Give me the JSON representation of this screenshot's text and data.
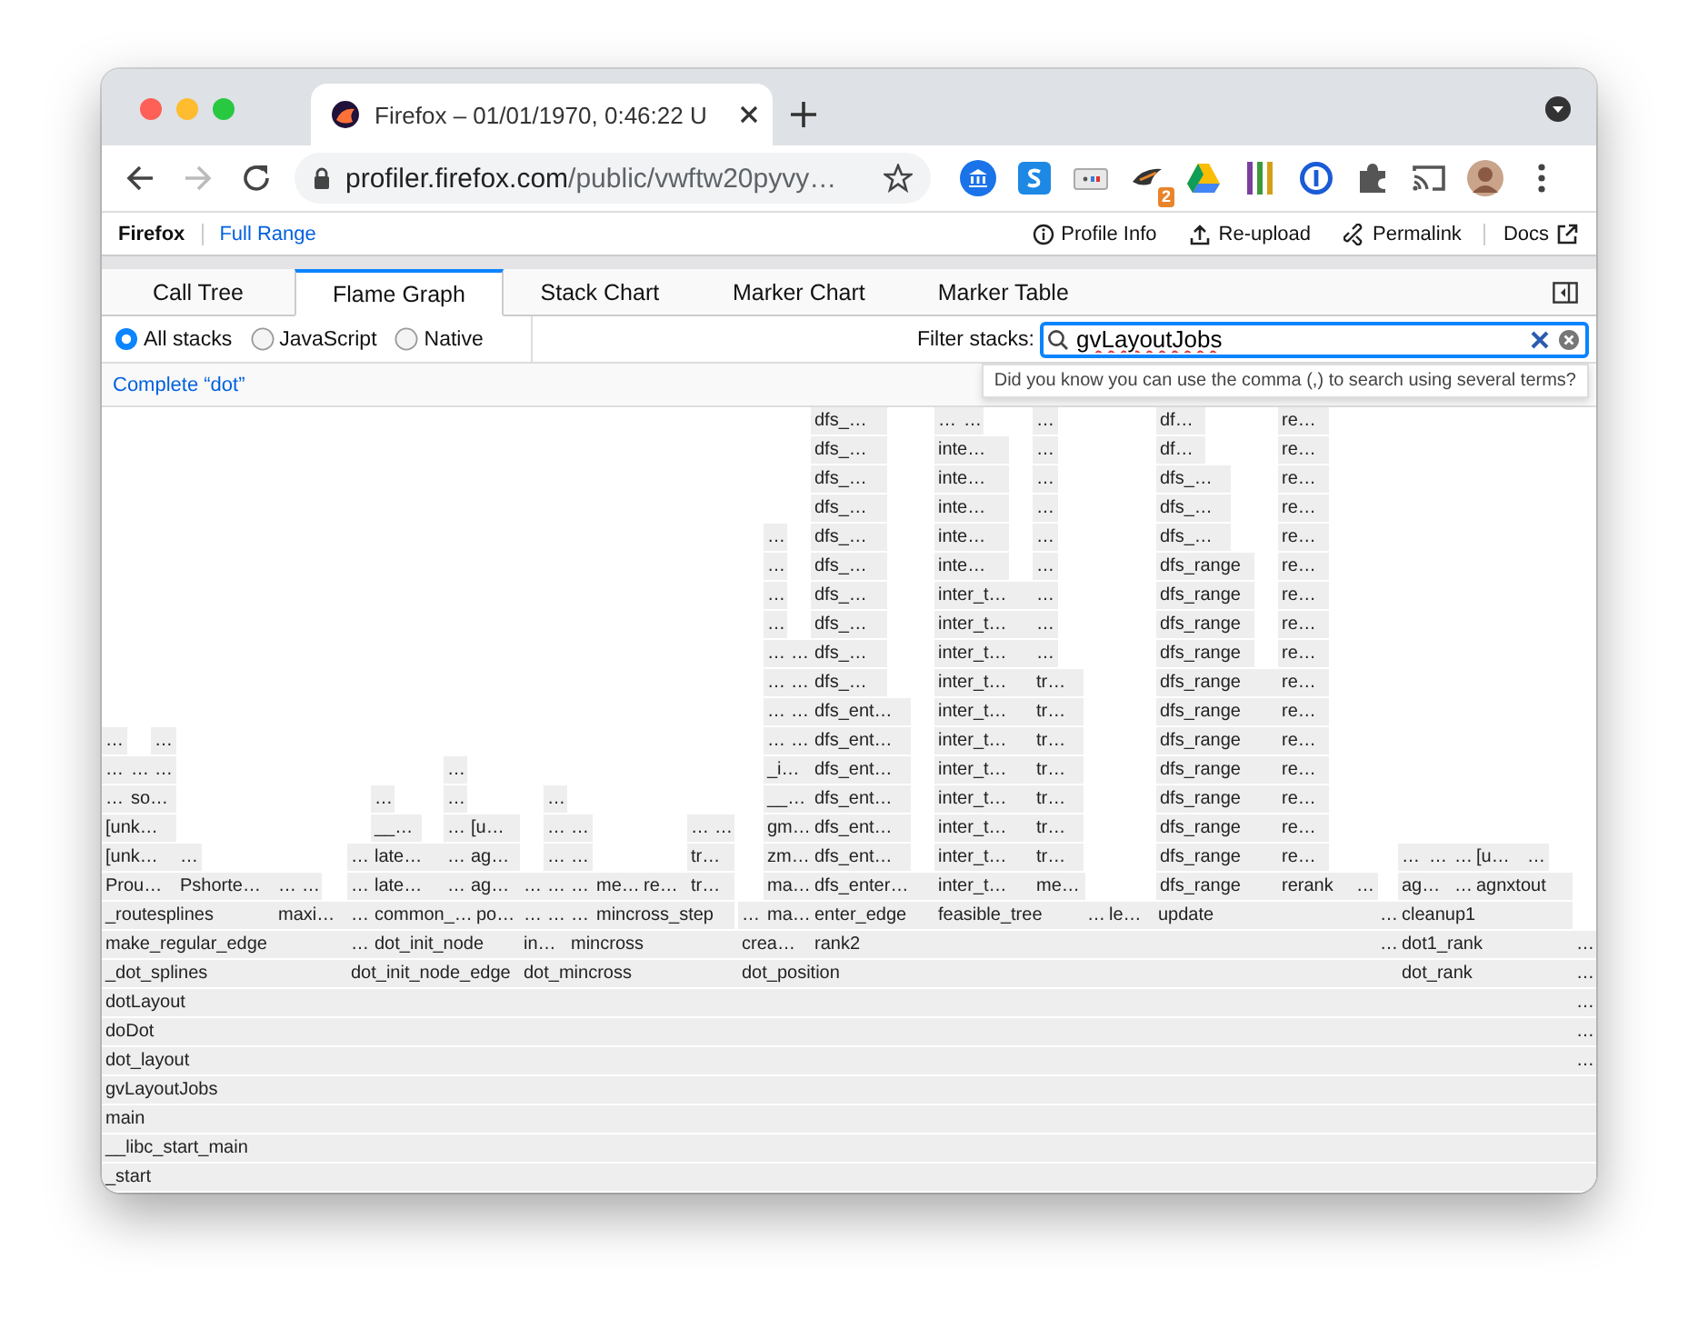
{
  "browser": {
    "tab_title": "Firefox – 01/01/1970, 0:46:22 U",
    "url_host": "profiler.firefox.com",
    "url_path": "/public/vwftw20pyvy…",
    "extension_badge": "2"
  },
  "profiler": {
    "product": "Firefox",
    "range": "Full Range",
    "actions": [
      "Profile Info",
      "Re-upload",
      "Permalink",
      "Docs"
    ]
  },
  "tabs": [
    {
      "label": "Call Tree",
      "selected": false
    },
    {
      "label": "Flame Graph",
      "selected": true
    },
    {
      "label": "Stack Chart",
      "selected": false
    },
    {
      "label": "Marker Chart",
      "selected": false
    },
    {
      "label": "Marker Table",
      "selected": false
    }
  ],
  "stack_types": [
    {
      "label": "All stacks",
      "selected": true
    },
    {
      "label": "JavaScript",
      "selected": false
    },
    {
      "label": "Native",
      "selected": false
    }
  ],
  "filter": {
    "label": "Filter stacks:",
    "value": "gvLayoutJobs",
    "tooltip": "Did you know you can use the comma (,) to search using several terms?"
  },
  "transform": "Complete “dot”",
  "flame_graph": {
    "stack_levels": [
      {
        "frames": [
          "dfs_…",
          "…",
          "…",
          "…",
          "df…",
          "re…"
        ]
      },
      {
        "frames": [
          "dfs_…",
          "inte…",
          "…",
          "df…",
          "re…"
        ]
      },
      {
        "frames": [
          "dfs_…",
          "inte…",
          "…",
          "dfs_…",
          "re…"
        ]
      },
      {
        "frames": [
          "dfs_…",
          "inte…",
          "…",
          "dfs_…",
          "re…"
        ]
      },
      {
        "frames": [
          "…",
          "dfs_…",
          "inte…",
          "…",
          "dfs_…",
          "re…"
        ]
      },
      {
        "frames": [
          "…",
          "dfs_…",
          "inte…",
          "…",
          "dfs_range",
          "re…"
        ]
      },
      {
        "frames": [
          "…",
          "dfs_…",
          "inter_t…",
          "…",
          "dfs_range",
          "re…"
        ]
      },
      {
        "frames": [
          "…",
          "dfs_…",
          "inter_t…",
          "…",
          "dfs_range",
          "re…"
        ]
      },
      {
        "frames": [
          "…",
          "…",
          "dfs_…",
          "inter_t…",
          "…",
          "dfs_range",
          "re…"
        ]
      },
      {
        "frames": [
          "…",
          "…",
          "dfs_…",
          "inter_t…",
          "tr…",
          "dfs_range",
          "re…"
        ]
      },
      {
        "frames": [
          "…",
          "…",
          "dfs_ent…",
          "inter_t…",
          "tr…",
          "dfs_range",
          "re…"
        ]
      },
      {
        "frames": [
          "…",
          "…",
          "…",
          "…",
          "dfs_ent…",
          "inter_t…",
          "tr…",
          "dfs_range",
          "re…"
        ]
      },
      {
        "frames": [
          "…",
          "…",
          "…",
          "…",
          "_i…",
          "dfs_ent…",
          "inter_t…",
          "tr…",
          "dfs_range",
          "re…"
        ]
      },
      {
        "frames": [
          "…",
          "so…",
          "…",
          "…",
          "…",
          "__…",
          "dfs_ent…",
          "inter_t…",
          "tr…",
          "dfs_range",
          "re…"
        ]
      },
      {
        "frames": [
          "[unk…",
          "__…",
          "…",
          "[u…",
          "…",
          "…",
          "…",
          "…",
          "gm…",
          "dfs_ent…",
          "inter_t…",
          "tr…",
          "dfs_range",
          "re…"
        ]
      },
      {
        "frames": [
          "[unk…",
          "…",
          "…",
          "late…",
          "…",
          "ag…",
          "…",
          "…",
          "tr…",
          "zm…",
          "dfs_ent…",
          "inter_t…",
          "tr…",
          "dfs_range",
          "re…",
          "…",
          "…",
          "…",
          "[u…",
          "…"
        ]
      },
      {
        "frames": [
          "Prou…",
          "Pshorte…",
          "…",
          "…",
          "…",
          "late…",
          "…",
          "ag…",
          "…",
          "…",
          "…",
          "me…",
          "re…",
          "tr…",
          "ma…",
          "dfs_enter…",
          "inter_t…",
          "me…",
          "dfs_range",
          "rerank",
          "…",
          "ag…",
          "…",
          "agnxtout"
        ]
      },
      {
        "frames": [
          "_routesplines",
          "maxi…",
          "…",
          "common_…",
          "po…",
          "…",
          "…",
          "…",
          "mincross_step",
          "…",
          "ma…",
          "enter_edge",
          "feasible_tree",
          "…",
          "le…",
          "update",
          "…",
          "cleanup1"
        ]
      },
      {
        "frames": [
          "make_regular_edge",
          "…",
          "dot_init_node",
          "in…",
          "mincross",
          "crea…",
          "rank2",
          "…",
          "dot1_rank",
          "…"
        ]
      },
      {
        "frames": [
          "_dot_splines",
          "dot_init_node_edge",
          "dot_mincross",
          "dot_position",
          "dot_rank",
          "…"
        ]
      },
      {
        "frames": [
          "dotLayout",
          "…"
        ]
      },
      {
        "frames": [
          "doDot",
          "…"
        ]
      },
      {
        "frames": [
          "dot_layout",
          "…"
        ]
      },
      {
        "frames": [
          "gvLayoutJobs"
        ]
      },
      {
        "frames": [
          "main"
        ]
      },
      {
        "frames": [
          "__libc_start_main"
        ]
      },
      {
        "frames": [
          "_start"
        ]
      }
    ]
  }
}
